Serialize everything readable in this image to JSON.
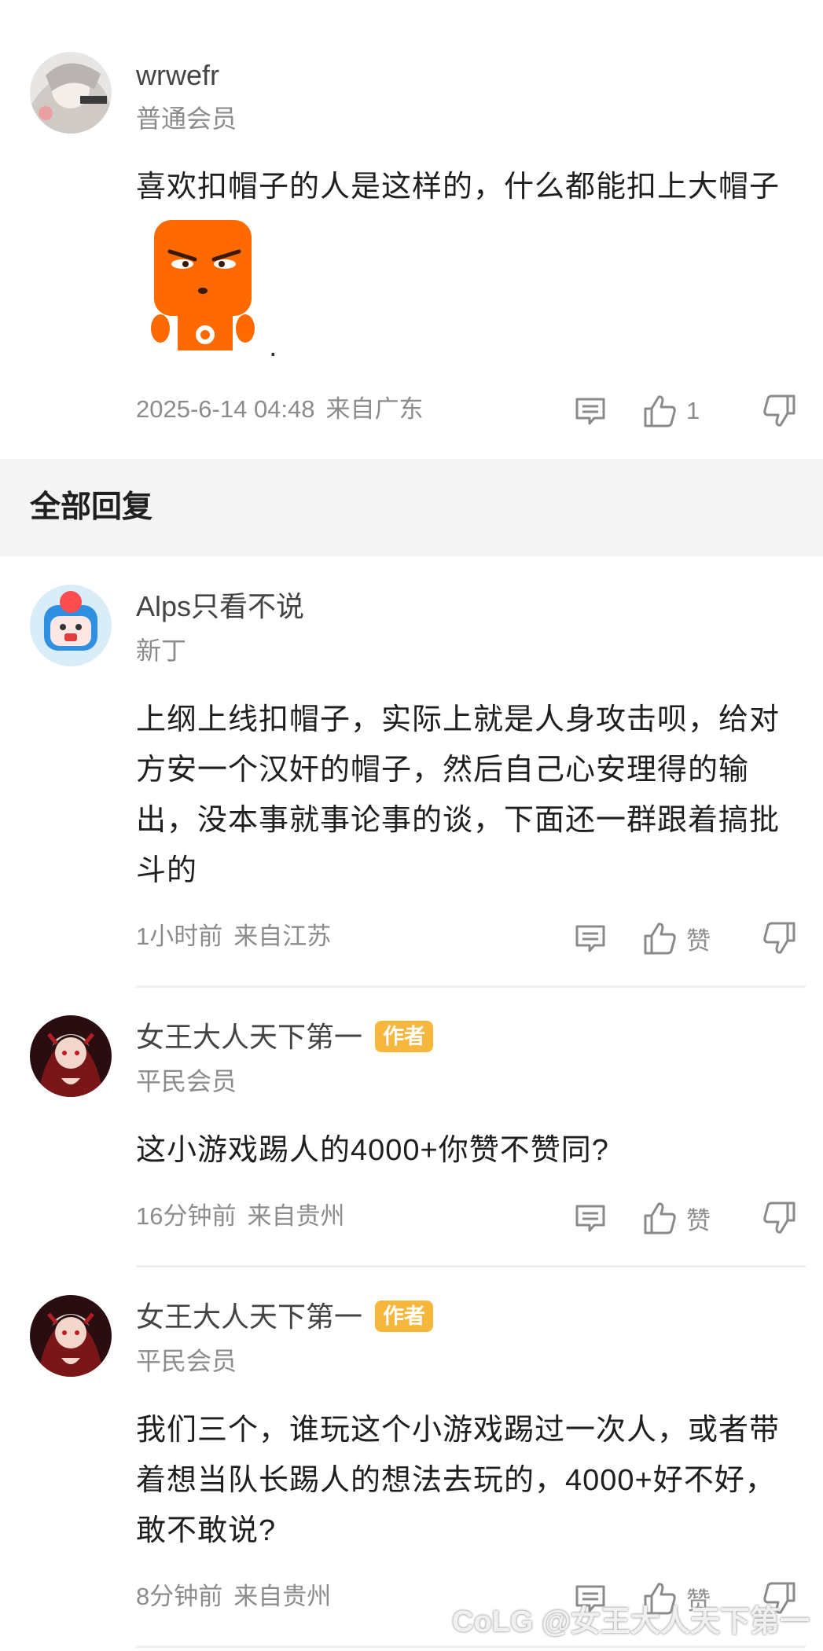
{
  "main_comment": {
    "username": "wrwefr",
    "level": "普通会员",
    "text": "喜欢扣帽子的人是这样的，什么都能扣上大帽子",
    "trailing": ".",
    "time": "2025-6-14 04:48",
    "location": "来自广东",
    "like_count": "1"
  },
  "section": {
    "title": "全部回复"
  },
  "replies": [
    {
      "username": "Alps只看不说",
      "level": "新丁",
      "text": "上纲上线扣帽子，实际上就是人身攻击呗，给对方安一个汉奸的帽子，然后自己心安理得的输出，没本事就事论事的谈，下面还一群跟着搞批斗的",
      "time": "1小时前",
      "location": "来自江苏",
      "like_label": "赞"
    },
    {
      "username": "女王大人天下第一",
      "badge": "作者",
      "level": "平民会员",
      "text": "这小游戏踢人的4000+你赞不赞同?",
      "time": "16分钟前",
      "location": "来自贵州",
      "like_label": "赞"
    },
    {
      "username": "女王大人天下第一",
      "badge": "作者",
      "level": "平民会员",
      "text": "我们三个，谁玩这个小游戏踢过一次人，或者带着想当队长踢人的想法去玩的，4000+好不好，敢不敢说?",
      "time": "8分钟前",
      "location": "来自贵州",
      "like_label": "赞"
    }
  ],
  "watermark": "@女王大人天下第一",
  "watermark_logo": "CoLG",
  "icons": {
    "reply": "comment-icon",
    "like": "thumbs-up-icon",
    "dislike": "thumbs-down-icon"
  },
  "colors": {
    "badge": "#f6b73c",
    "section_bg": "#f4f4f4",
    "meta_text": "#8c8c8c",
    "emoji_orange": "#ff6a00"
  }
}
